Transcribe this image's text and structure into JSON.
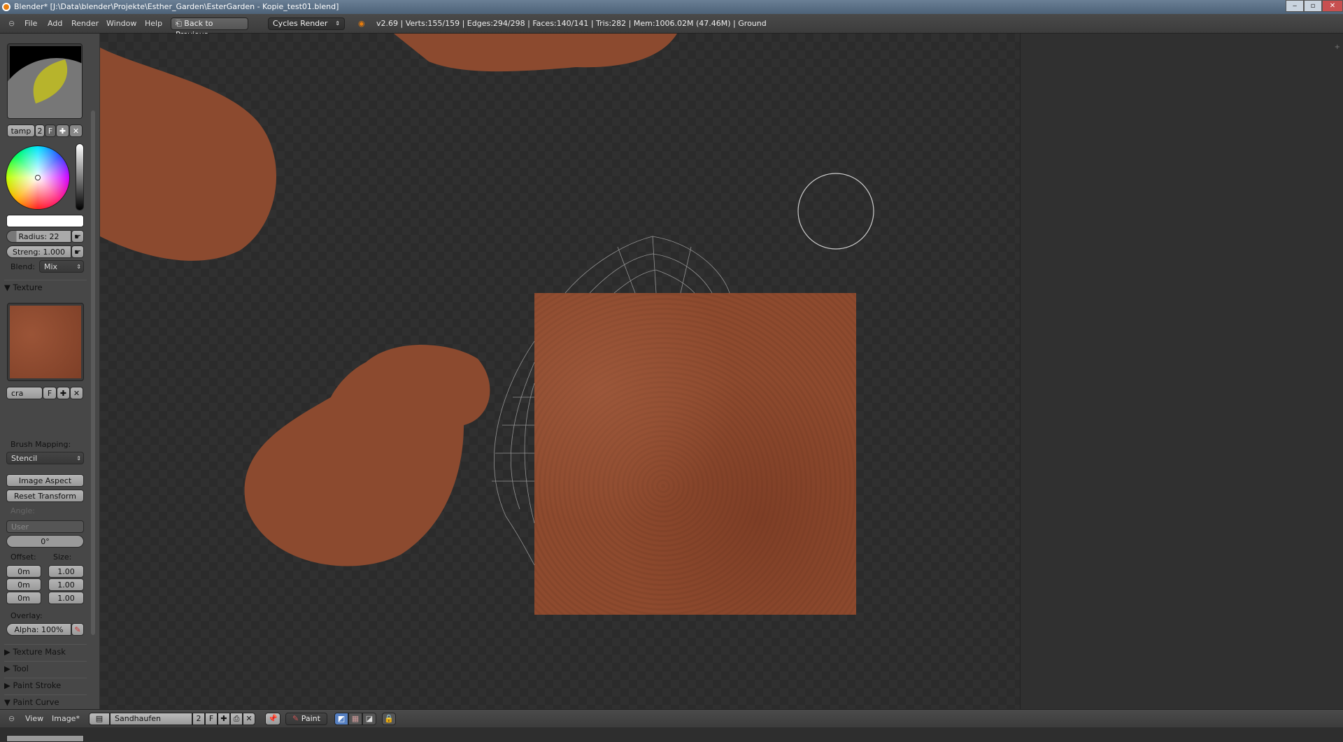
{
  "window": {
    "title": "Blender* [J:\\Data\\blender\\Projekte\\Esther_Garden\\EsterGarden - Kopie_test01.blend]",
    "controls": [
      "‒",
      "▫",
      "✕"
    ]
  },
  "header": {
    "menus": [
      "File",
      "Add",
      "Render",
      "Window",
      "Help"
    ],
    "back_label": "Back to Previous",
    "engine": "Cycles Render",
    "stats": "v2.69 | Verts:155/159 | Edges:294/298 | Faces:140/141 | Tris:282 | Mem:1006.02M (47.46M) | Ground"
  },
  "brush": {
    "name": "tamp",
    "users": "2",
    "fake": "F",
    "radius": "Radius: 22",
    "strength": "Streng: 1.000",
    "blend_label": "Blend:",
    "blend": "Mix",
    "color": "#ffffff"
  },
  "texture": {
    "header": "Texture",
    "name": "cra",
    "fake": "F",
    "mapping_label": "Brush Mapping:",
    "mapping": "Stencil",
    "image_aspect": "Image Aspect",
    "reset_transform": "Reset Transform",
    "angle_label": "Angle:",
    "angle_mode": "User",
    "angle": "0°",
    "offset_label": "Offset:",
    "size_label": "Size:",
    "offset": [
      "0m",
      "0m",
      "0m"
    ],
    "size": [
      "1.00",
      "1.00",
      "1.00"
    ],
    "overlay_label": "Overlay:",
    "alpha": "Alpha: 100%"
  },
  "panels": [
    {
      "label": "Texture Mask",
      "open": false
    },
    {
      "label": "Tool",
      "open": false
    },
    {
      "label": "Paint Stroke",
      "open": false
    },
    {
      "label": "Paint Curve",
      "open": true
    }
  ],
  "bottom": {
    "menus": [
      "View",
      "Image*"
    ],
    "image_name": "Sandhaufen",
    "users": "2",
    "fake": "F",
    "mode": "Paint"
  },
  "colors": {
    "dirt": "#8c4a2f",
    "viewport": "#2b2b2b",
    "accent": "#5680c2"
  }
}
